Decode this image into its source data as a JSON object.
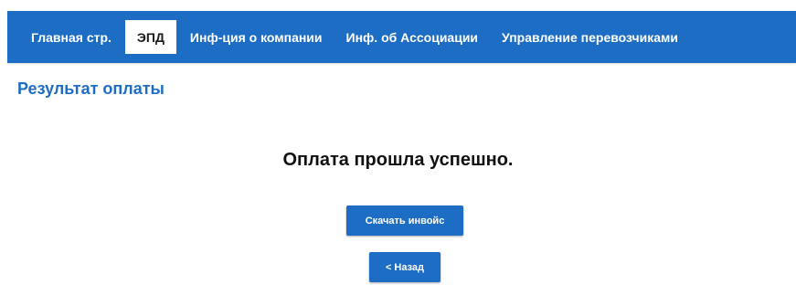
{
  "nav": {
    "items": [
      {
        "label": "Главная стр.",
        "active": false
      },
      {
        "label": "ЭПД",
        "active": true
      },
      {
        "label": "Инф-ция о компании",
        "active": false
      },
      {
        "label": "Инф. об Ассоциации",
        "active": false
      },
      {
        "label": "Управление перевозчиками",
        "active": false
      }
    ]
  },
  "page": {
    "title": "Результат оплаты",
    "message": "Оплата прошла успешно."
  },
  "actions": {
    "download_label": "Скачать инвойс",
    "back_label": "< Назад"
  },
  "colors": {
    "accent": "#1e6dc4",
    "nav_active_bg": "#ffffff"
  }
}
